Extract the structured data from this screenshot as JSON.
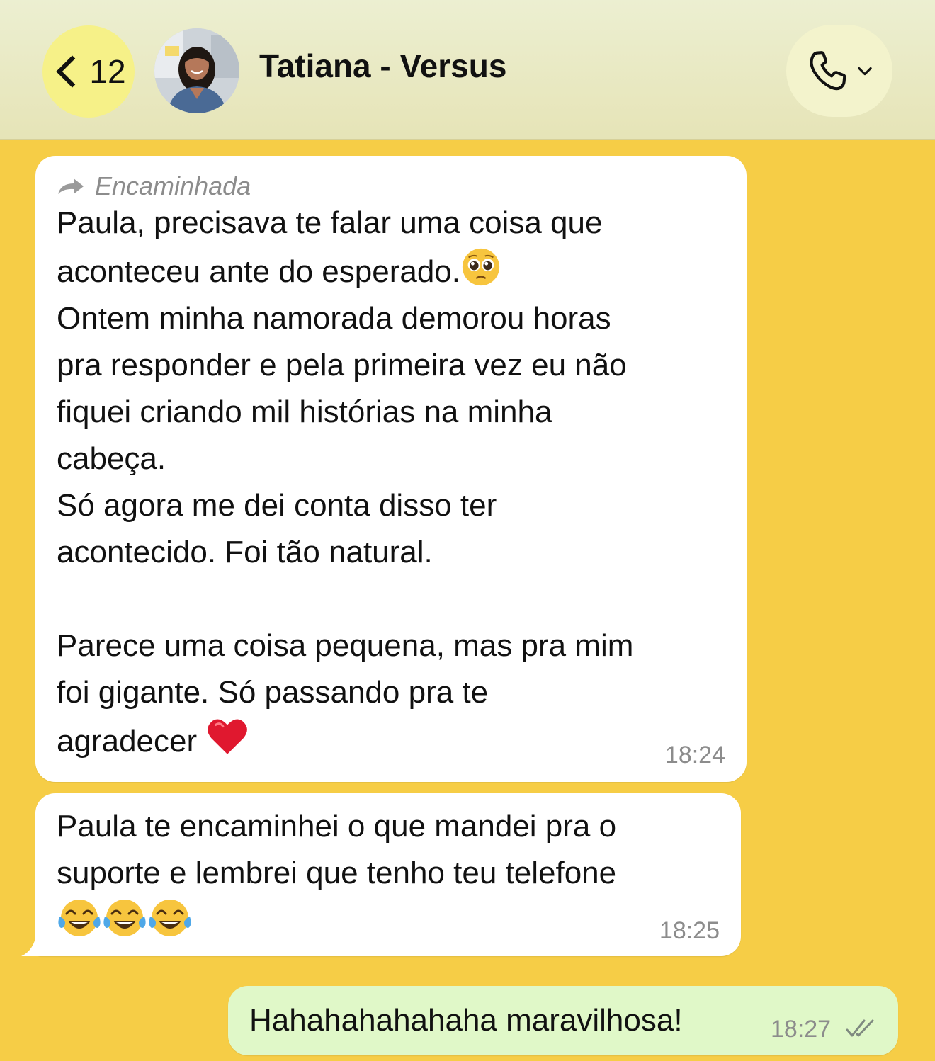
{
  "header": {
    "back_count": "12",
    "contact_name": "Tatiana - Versus"
  },
  "messages": [
    {
      "direction": "incoming",
      "forwarded_label": "Encaminhada",
      "text_a": "Paula, precisava te falar uma coisa que\naconteceu ante do esperado.",
      "emoji_a": "pleading-face",
      "text_b": "\nOntem minha namorada demorou horas\npra responder e pela primeira vez eu não\nfiquei criando mil histórias na minha\ncabeça.\nSó agora me dei conta disso ter\nacontecido. Foi tão natural.\n\nParece uma coisa pequena, mas pra mim\nfoi gigante. Só passando pra te\nagradecer ",
      "emoji_b": "red-heart",
      "time": "18:24"
    },
    {
      "direction": "incoming",
      "text": "Paula te encaminhei o que mandei pra o\nsuporte e lembrei que tenho teu telefone\n",
      "emoji": [
        "tears-of-joy",
        "tears-of-joy",
        "tears-of-joy"
      ],
      "time": "18:25"
    },
    {
      "direction": "outgoing",
      "text": "Hahahahahahaha maravilhosa!",
      "time": "18:27",
      "status": "read"
    }
  ],
  "colors": {
    "wallpaper": "#f6cd46",
    "incoming_bubble": "#ffffff",
    "outgoing_bubble": "#e0f8c8",
    "back_button": "#f6f188"
  },
  "icons": {
    "back": "chevron-left-icon",
    "call": "phone-icon",
    "forwarded": "forward-arrow-icon",
    "read_status": "double-check-icon"
  }
}
